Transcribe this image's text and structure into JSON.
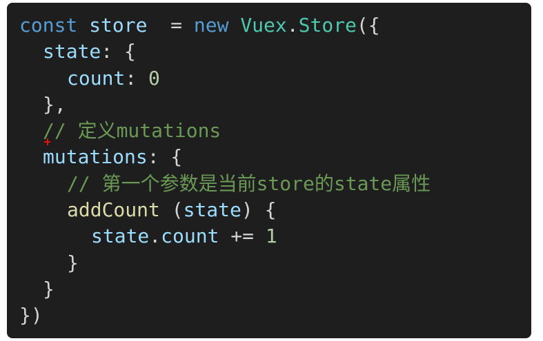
{
  "code": {
    "l1": {
      "kw_const": "const",
      "name": "store",
      "assign": "  = ",
      "kw_new": "new",
      "ns": "Vuex",
      "dot": ".",
      "cls": "Store",
      "open": "({"
    },
    "l2": {
      "key": "state",
      "rest": ": {"
    },
    "l3": {
      "key": "count",
      "colon": ": ",
      "value": "0"
    },
    "l4": {
      "text": "},"
    },
    "l5": {
      "comment": "// 定义mutations"
    },
    "l6": {
      "key": "mutations",
      "rest": ": {"
    },
    "l7": {
      "comment": "// 第一个参数是当前store的state属性"
    },
    "l8": {
      "fn": "addCount",
      "paren_open": " (",
      "param": "state",
      "paren_close": ") {"
    },
    "l9": {
      "obj": "state",
      "dot": ".",
      "prop": "count",
      "op": " += ",
      "value": "1"
    },
    "l10": {
      "text": "}"
    },
    "l11": {
      "text": "}"
    },
    "l12": {
      "text": "})"
    }
  },
  "colors": {
    "background": "#1e1e1e",
    "keyword": "#569cd6",
    "variable": "#9cdcfe",
    "class": "#4ec9b0",
    "function": "#dcdcaa",
    "number": "#b5cea8",
    "comment": "#6a9955",
    "marker": "#e51400"
  }
}
